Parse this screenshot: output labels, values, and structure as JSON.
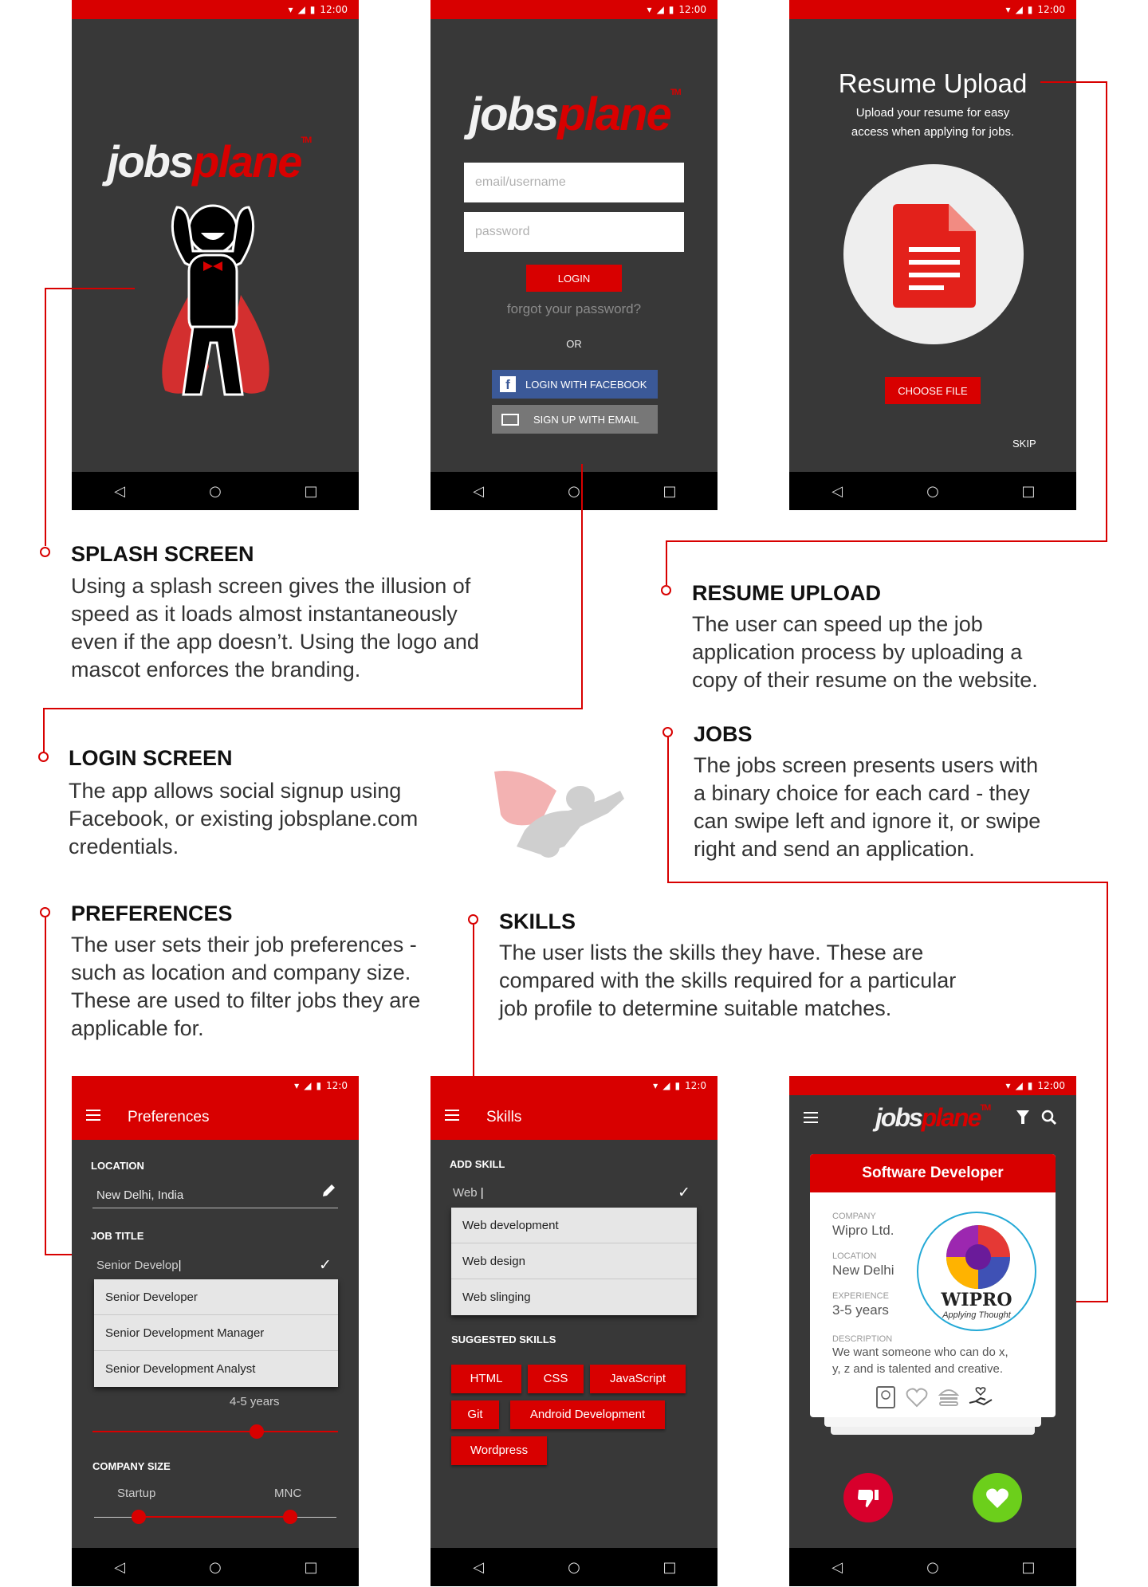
{
  "status": {
    "time": "12:00",
    "time_short": "12:0"
  },
  "nav": {
    "back": "◁",
    "home": "○",
    "recent": "□"
  },
  "logo": {
    "jobs": "jobs",
    "plane": "plane",
    "tm": "TM"
  },
  "login": {
    "email_placeholder": "email/username",
    "password_placeholder": "password",
    "login_button": "LOGIN",
    "forgot": "forgot your password?",
    "or": "OR",
    "facebook": "LOGIN WITH FACEBOOK",
    "email_signup": "SIGN UP WITH EMAIL",
    "facebook_color": "#3b5998"
  },
  "resume": {
    "title": "Resume Upload",
    "subtitle_line1": "Upload your resume for easy",
    "subtitle_line2": "access when applying for jobs.",
    "choose_file": "CHOOSE FILE",
    "skip": "SKIP"
  },
  "annotations": {
    "splash": {
      "title": "SPLASH SCREEN",
      "lines": [
        "Using a splash screen gives the illusion of",
        "speed as it loads almost instantaneously",
        "even if the app doesn’t. Using the logo and",
        "mascot enforces the branding."
      ]
    },
    "resume": {
      "title": "RESUME UPLOAD",
      "lines": [
        "The user can speed up the job",
        "application process by uploading a",
        "copy of their resume on the website."
      ]
    },
    "login": {
      "title": "LOGIN SCREEN",
      "lines": [
        "The app allows social signup using",
        "Facebook, or existing jobsplane.com",
        "credentials."
      ]
    },
    "jobs": {
      "title": "JOBS",
      "lines": [
        "The jobs screen presents users with",
        "a binary choice for each card - they",
        "can swipe left and ignore it, or swipe",
        "right and send an application."
      ]
    },
    "preferences": {
      "title": "PREFERENCES",
      "lines": [
        "The user sets their job preferences -",
        "such as location and company size.",
        "These are used to filter jobs they are",
        "applicable for."
      ]
    },
    "skills": {
      "title": "SKILLS",
      "lines": [
        "The user lists the skills they have. These are",
        "compared with the skills required for a particular",
        "job profile to determine suitable matches."
      ]
    }
  },
  "preferences": {
    "title": "Preferences",
    "location_label": "LOCATION",
    "location_value": "New Delhi, India",
    "job_title_label": "JOB TITLE",
    "job_title_value": "Senior Develop",
    "suggestions": [
      "Senior Developer",
      "Senior Development Manager",
      "Senior Development Analyst"
    ],
    "experience_value": "4-5 years",
    "experience_fraction": 0.67,
    "company_size_label": "COMPANY SIZE",
    "company_min": "Startup",
    "company_max": "MNC"
  },
  "skills": {
    "title": "Skills",
    "add_label": "ADD SKILL",
    "add_value": "Web",
    "suggestions": [
      "Web development",
      "Web design",
      "Web slinging"
    ],
    "suggested_label": "SUGGESTED SKILLS",
    "chips": [
      "HTML",
      "CSS",
      "JavaScript",
      "Git",
      "Android Development",
      "Wordpress"
    ]
  },
  "jobs": {
    "card_title": "Software Developer",
    "company_label": "COMPANY",
    "company": "Wipro Ltd.",
    "location_label": "LOCATION",
    "location": "New Delhi",
    "experience_label": "EXPERIENCE",
    "experience": "3-5 years",
    "description_label": "DESCRIPTION",
    "description_line1": "We want someone who can do x,",
    "description_line2": "y, z and is talented and creative.",
    "wipro_name": "WIPRO",
    "wipro_tagline": "Applying Thought",
    "dislike_color": "#d8002c",
    "like_color": "#6ccf1b"
  },
  "colors": {
    "brand_red": "#d80000",
    "screen_bg": "#383838"
  }
}
